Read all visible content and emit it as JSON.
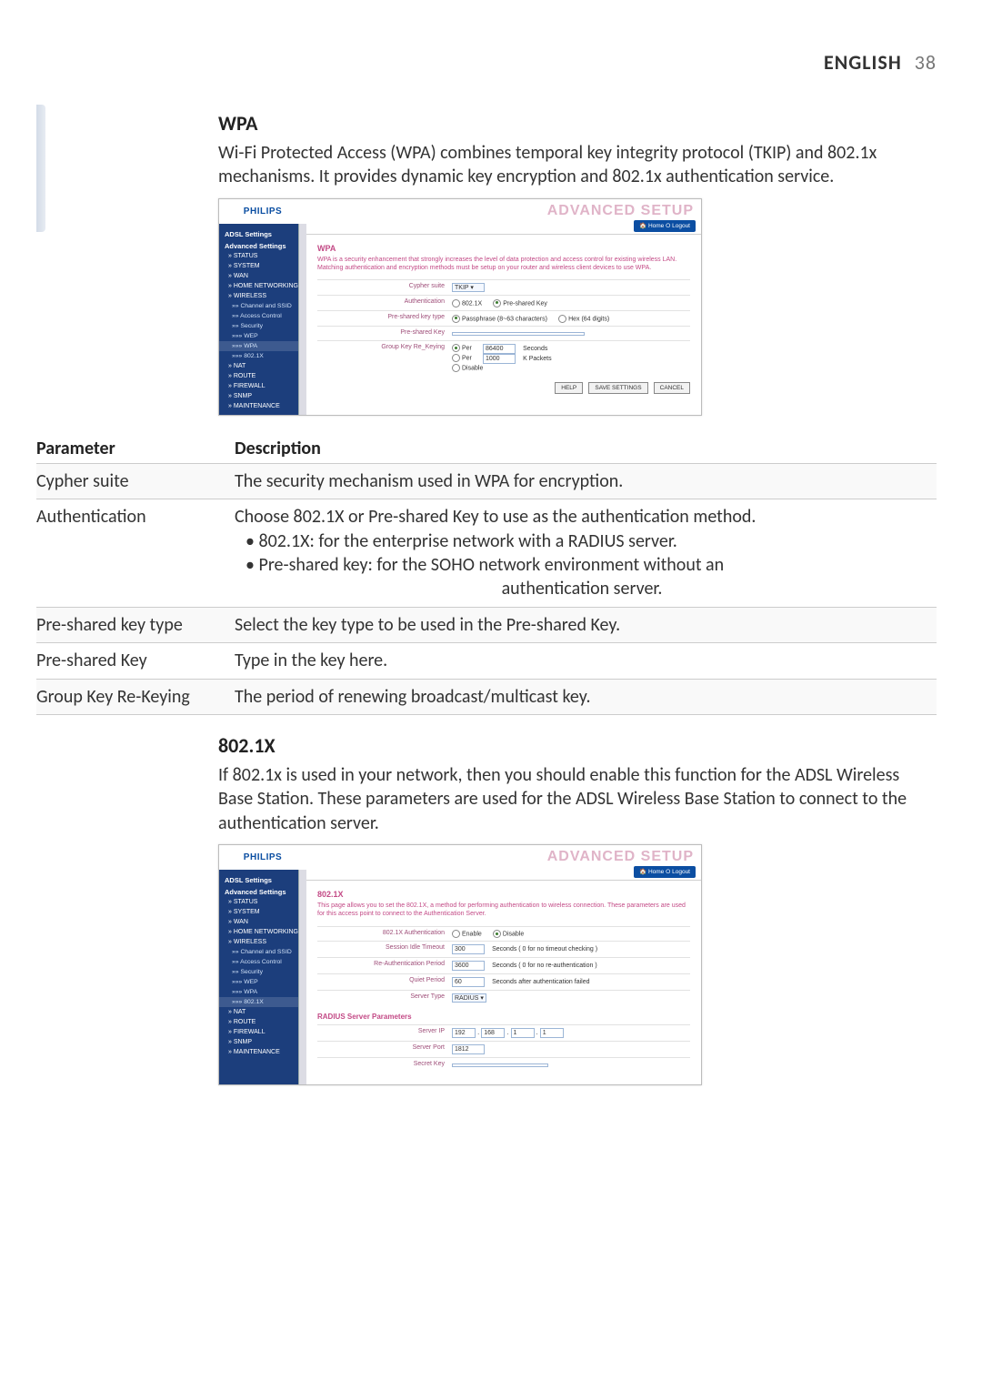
{
  "header": {
    "language": "ENGLISH",
    "page_number": "38"
  },
  "wpa": {
    "heading": "WPA",
    "intro": "Wi-Fi Protected Access (WPA) combines temporal key integrity protocol (TKIP) and 802.1x mechanisms. It provides dynamic key encryption and 802.1x authentication service."
  },
  "wpa_screenshot": {
    "brand": "PHILIPS",
    "banner": "ADVANCED SETUP",
    "top_links": "🏠 Home  ⭘ Logout",
    "title": "WPA",
    "description": "WPA is a security enhancement that strongly increases the level of data protection and access control for existing wireless LAN. Matching authentication and encryption methods must be setup on your router and wireless client devices to use WPA.",
    "rows": {
      "cypher_suite": {
        "label": "Cypher suite",
        "value": "TKIP"
      },
      "authentication": {
        "label": "Authentication",
        "opt1": "802.1X",
        "opt2": "Pre-shared Key"
      },
      "psk_type": {
        "label": "Pre-shared key type",
        "opt1": "Passphrase (8~63 characters)",
        "opt2": "Hex (64 digits)"
      },
      "psk": {
        "label": "Pre-shared Key"
      },
      "rekey": {
        "label": "Group Key Re_Keying",
        "per_seconds_label": "Per",
        "per_seconds_value": "86400",
        "per_seconds_unit": "Seconds",
        "per_packets_label": "Per",
        "per_packets_value": "1000",
        "per_packets_unit": "K Packets",
        "disable_label": "Disable"
      }
    },
    "buttons": {
      "help": "HELP",
      "save": "SAVE SETTINGS",
      "cancel": "CANCEL"
    }
  },
  "sidebar": {
    "groups": {
      "adsl": "ADSL Settings",
      "advanced": "Advanced Settings"
    },
    "items": {
      "status": "» STATUS",
      "system": "» SYSTEM",
      "wan": "» WAN",
      "home_net": "» HOME NETWORKING",
      "wireless": "» WIRELESS",
      "channel": "»» Channel and SSID",
      "access": "»» Access Control",
      "security": "»» Security",
      "wep": "»»» WEP",
      "wpa": "»»» WPA",
      "dot1x": "»»» 802.1X",
      "nat": "» NAT",
      "route": "» ROUTE",
      "firewall": "» FIREWALL",
      "snmp": "» SNMP",
      "maintenance": "» MAINTENANCE"
    }
  },
  "param_table": {
    "col_param": "Parameter",
    "col_desc": "Description",
    "rows": [
      {
        "param": "Cypher suite",
        "desc": "The security mechanism used in WPA for encryption."
      },
      {
        "param": "Authentication",
        "desc_line1": "Choose 802.1X or Pre-shared Key to use as the authentication method.",
        "bullet1": "802.1X: for the enterprise network with a RADIUS server.",
        "bullet2": "Pre-shared key: for the SOHO network environment without an",
        "bullet2_cont": "authentication server."
      },
      {
        "param": "Pre-shared key type",
        "desc": "Select the key type to be used in the Pre-shared Key."
      },
      {
        "param": "Pre-shared Key",
        "desc": "Type in the key here."
      },
      {
        "param": "Group Key Re-Keying",
        "desc": "The period of renewing broadcast/multicast key."
      }
    ]
  },
  "dot1x": {
    "heading": "802.1X",
    "intro": "If 802.1x is used in your network, then you should enable this function for the ADSL Wireless Base Station. These parameters are used for the ADSL Wireless Base Station to connect to the authentication server."
  },
  "dot1x_screenshot": {
    "brand": "PHILIPS",
    "banner": "ADVANCED SETUP",
    "top_links": "🏠 Home  ⭘ Logout",
    "title": "802.1X",
    "description": "This page allows you to set the 802.1X, a method for performing authentication to wireless connection. These parameters are used for this access point to connect to the Authentication Server.",
    "rows": {
      "auth": {
        "label": "802.1X Authentication",
        "opt1": "Enable",
        "opt2": "Disable"
      },
      "idle": {
        "label": "Session Idle Timeout",
        "value": "300",
        "unit": "Seconds ( 0 for no timeout checking )"
      },
      "reauth": {
        "label": "Re-Authentication Period",
        "value": "3600",
        "unit": "Seconds ( 0 for no re-authentication )"
      },
      "quiet": {
        "label": "Quiet Period",
        "value": "60",
        "unit": "Seconds after authentication failed"
      },
      "servertype": {
        "label": "Server Type",
        "value": "RADIUS"
      }
    },
    "radius": {
      "heading": "RADIUS Server Parameters",
      "server_ip": {
        "label": "Server IP",
        "o1": "192",
        "o2": "168",
        "o3": "1",
        "o4": "1"
      },
      "server_port": {
        "label": "Server Port",
        "value": "1812"
      },
      "secret_key": {
        "label": "Secret Key"
      }
    }
  }
}
